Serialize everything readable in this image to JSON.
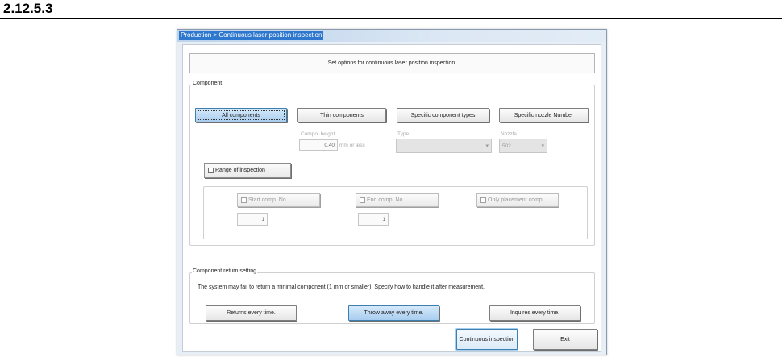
{
  "section_number": "2.12.5.3",
  "window": {
    "title": "Production > Continuous laser position inspection",
    "header_text": "Set options for continuous laser position inspection."
  },
  "component": {
    "group_label": "Component",
    "buttons": {
      "all": "All components",
      "thin": "Thin components",
      "specific_types": "Specific component types",
      "specific_nozzle": "Specific nozzle Number"
    },
    "compo_height": {
      "label": "Compo. height",
      "value": "0.40",
      "unit": "mm or less"
    },
    "type": {
      "label": "Type",
      "value": ""
    },
    "nozzle": {
      "label": "Nozzle",
      "value": "502"
    },
    "range": {
      "label": "Range of inspection",
      "start_label": "Start comp. No.",
      "start_value": "1",
      "end_label": "End comp. No.",
      "end_value": "1",
      "only_placement_label": "Only placement comp."
    }
  },
  "return_setting": {
    "group_label": "Component return setting",
    "description": "The system may fail to return a minimal component (1 mm or smaller). Specify how to handle it after measurement.",
    "buttons": {
      "returns": "Returns every time.",
      "throw_away": "Throw away every time.",
      "inquires": "Inquires every time."
    }
  },
  "footer": {
    "continuous_inspection": "Continuous inspection",
    "exit": "Exit"
  },
  "colors": {
    "active_button": "#a9cdef",
    "title_highlight": "#2d77cf"
  }
}
